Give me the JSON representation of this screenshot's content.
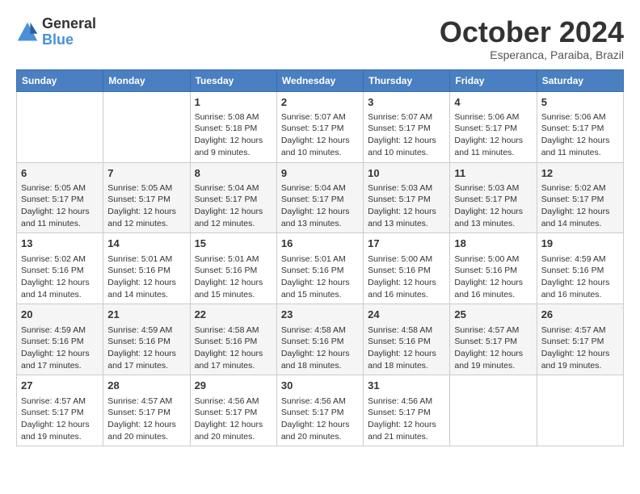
{
  "header": {
    "logo_line1": "General",
    "logo_line2": "Blue",
    "month": "October 2024",
    "location": "Esperanca, Paraiba, Brazil"
  },
  "days_of_week": [
    "Sunday",
    "Monday",
    "Tuesday",
    "Wednesday",
    "Thursday",
    "Friday",
    "Saturday"
  ],
  "weeks": [
    [
      {
        "day": "",
        "info": ""
      },
      {
        "day": "",
        "info": ""
      },
      {
        "day": "1",
        "sunrise": "Sunrise: 5:08 AM",
        "sunset": "Sunset: 5:18 PM",
        "daylight": "Daylight: 12 hours and 9 minutes."
      },
      {
        "day": "2",
        "sunrise": "Sunrise: 5:07 AM",
        "sunset": "Sunset: 5:17 PM",
        "daylight": "Daylight: 12 hours and 10 minutes."
      },
      {
        "day": "3",
        "sunrise": "Sunrise: 5:07 AM",
        "sunset": "Sunset: 5:17 PM",
        "daylight": "Daylight: 12 hours and 10 minutes."
      },
      {
        "day": "4",
        "sunrise": "Sunrise: 5:06 AM",
        "sunset": "Sunset: 5:17 PM",
        "daylight": "Daylight: 12 hours and 11 minutes."
      },
      {
        "day": "5",
        "sunrise": "Sunrise: 5:06 AM",
        "sunset": "Sunset: 5:17 PM",
        "daylight": "Daylight: 12 hours and 11 minutes."
      }
    ],
    [
      {
        "day": "6",
        "sunrise": "Sunrise: 5:05 AM",
        "sunset": "Sunset: 5:17 PM",
        "daylight": "Daylight: 12 hours and 11 minutes."
      },
      {
        "day": "7",
        "sunrise": "Sunrise: 5:05 AM",
        "sunset": "Sunset: 5:17 PM",
        "daylight": "Daylight: 12 hours and 12 minutes."
      },
      {
        "day": "8",
        "sunrise": "Sunrise: 5:04 AM",
        "sunset": "Sunset: 5:17 PM",
        "daylight": "Daylight: 12 hours and 12 minutes."
      },
      {
        "day": "9",
        "sunrise": "Sunrise: 5:04 AM",
        "sunset": "Sunset: 5:17 PM",
        "daylight": "Daylight: 12 hours and 13 minutes."
      },
      {
        "day": "10",
        "sunrise": "Sunrise: 5:03 AM",
        "sunset": "Sunset: 5:17 PM",
        "daylight": "Daylight: 12 hours and 13 minutes."
      },
      {
        "day": "11",
        "sunrise": "Sunrise: 5:03 AM",
        "sunset": "Sunset: 5:17 PM",
        "daylight": "Daylight: 12 hours and 13 minutes."
      },
      {
        "day": "12",
        "sunrise": "Sunrise: 5:02 AM",
        "sunset": "Sunset: 5:17 PM",
        "daylight": "Daylight: 12 hours and 14 minutes."
      }
    ],
    [
      {
        "day": "13",
        "sunrise": "Sunrise: 5:02 AM",
        "sunset": "Sunset: 5:16 PM",
        "daylight": "Daylight: 12 hours and 14 minutes."
      },
      {
        "day": "14",
        "sunrise": "Sunrise: 5:01 AM",
        "sunset": "Sunset: 5:16 PM",
        "daylight": "Daylight: 12 hours and 14 minutes."
      },
      {
        "day": "15",
        "sunrise": "Sunrise: 5:01 AM",
        "sunset": "Sunset: 5:16 PM",
        "daylight": "Daylight: 12 hours and 15 minutes."
      },
      {
        "day": "16",
        "sunrise": "Sunrise: 5:01 AM",
        "sunset": "Sunset: 5:16 PM",
        "daylight": "Daylight: 12 hours and 15 minutes."
      },
      {
        "day": "17",
        "sunrise": "Sunrise: 5:00 AM",
        "sunset": "Sunset: 5:16 PM",
        "daylight": "Daylight: 12 hours and 16 minutes."
      },
      {
        "day": "18",
        "sunrise": "Sunrise: 5:00 AM",
        "sunset": "Sunset: 5:16 PM",
        "daylight": "Daylight: 12 hours and 16 minutes."
      },
      {
        "day": "19",
        "sunrise": "Sunrise: 4:59 AM",
        "sunset": "Sunset: 5:16 PM",
        "daylight": "Daylight: 12 hours and 16 minutes."
      }
    ],
    [
      {
        "day": "20",
        "sunrise": "Sunrise: 4:59 AM",
        "sunset": "Sunset: 5:16 PM",
        "daylight": "Daylight: 12 hours and 17 minutes."
      },
      {
        "day": "21",
        "sunrise": "Sunrise: 4:59 AM",
        "sunset": "Sunset: 5:16 PM",
        "daylight": "Daylight: 12 hours and 17 minutes."
      },
      {
        "day": "22",
        "sunrise": "Sunrise: 4:58 AM",
        "sunset": "Sunset: 5:16 PM",
        "daylight": "Daylight: 12 hours and 17 minutes."
      },
      {
        "day": "23",
        "sunrise": "Sunrise: 4:58 AM",
        "sunset": "Sunset: 5:16 PM",
        "daylight": "Daylight: 12 hours and 18 minutes."
      },
      {
        "day": "24",
        "sunrise": "Sunrise: 4:58 AM",
        "sunset": "Sunset: 5:16 PM",
        "daylight": "Daylight: 12 hours and 18 minutes."
      },
      {
        "day": "25",
        "sunrise": "Sunrise: 4:57 AM",
        "sunset": "Sunset: 5:17 PM",
        "daylight": "Daylight: 12 hours and 19 minutes."
      },
      {
        "day": "26",
        "sunrise": "Sunrise: 4:57 AM",
        "sunset": "Sunset: 5:17 PM",
        "daylight": "Daylight: 12 hours and 19 minutes."
      }
    ],
    [
      {
        "day": "27",
        "sunrise": "Sunrise: 4:57 AM",
        "sunset": "Sunset: 5:17 PM",
        "daylight": "Daylight: 12 hours and 19 minutes."
      },
      {
        "day": "28",
        "sunrise": "Sunrise: 4:57 AM",
        "sunset": "Sunset: 5:17 PM",
        "daylight": "Daylight: 12 hours and 20 minutes."
      },
      {
        "day": "29",
        "sunrise": "Sunrise: 4:56 AM",
        "sunset": "Sunset: 5:17 PM",
        "daylight": "Daylight: 12 hours and 20 minutes."
      },
      {
        "day": "30",
        "sunrise": "Sunrise: 4:56 AM",
        "sunset": "Sunset: 5:17 PM",
        "daylight": "Daylight: 12 hours and 20 minutes."
      },
      {
        "day": "31",
        "sunrise": "Sunrise: 4:56 AM",
        "sunset": "Sunset: 5:17 PM",
        "daylight": "Daylight: 12 hours and 21 minutes."
      },
      {
        "day": "",
        "info": ""
      },
      {
        "day": "",
        "info": ""
      }
    ]
  ]
}
